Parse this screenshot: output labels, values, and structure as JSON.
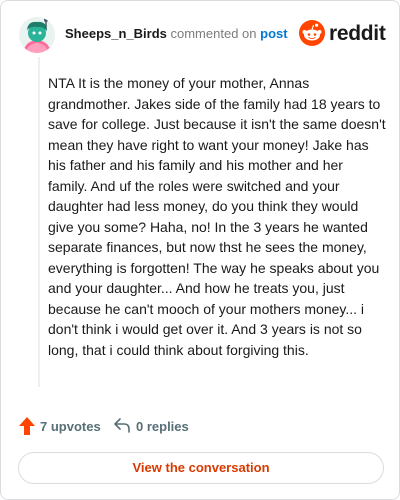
{
  "header": {
    "username": "Sheeps_n_Birds",
    "action_text": "commented on",
    "post_link": "post",
    "brand": "reddit",
    "avatar": "avatar-icon",
    "brand_icon": "reddit-snoo-icon"
  },
  "comment": {
    "body": "NTA It is the money of your mother, Annas grandmother. Jakes side of the family had 18 years to save for college. Just because it isn't the same doesn't mean they have right to want your money! Jake has his father and his family and his mother and her family. And uf the roles were switched and your daughter had less money, do you think they would give you some? Haha, no! In the 3 years he wanted separate finances, but now thst he sees the money, everything is forgotten! The way he speaks about you and your daughter... And how he treats you, just because he can't mooch of your mothers money... i don't think i would get over it. And 3 years is not so long, that i could think about forgiving this."
  },
  "actions": {
    "upvotes": "7 upvotes",
    "replies": "0 replies",
    "upvote_icon": "upvote-arrow-icon",
    "reply_icon": "reply-arrow-icon"
  },
  "cta": {
    "label": "View the conversation"
  },
  "colors": {
    "brand_orange": "#ff4500",
    "cta_text": "#d93a00",
    "link_blue": "#0079d3",
    "muted": "#576f76",
    "border": "#d9dde0"
  }
}
